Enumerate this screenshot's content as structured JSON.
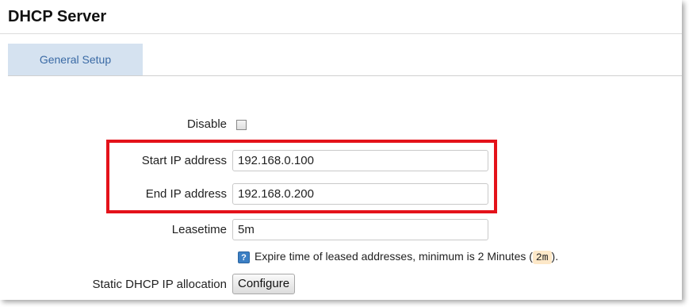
{
  "section": {
    "title": "DHCP Server"
  },
  "tabs": [
    {
      "label": "General Setup",
      "active": true
    }
  ],
  "fields": {
    "disable": {
      "label": "Disable",
      "checked": false
    },
    "start_ip": {
      "label": "Start IP address",
      "value": "192.168.0.100"
    },
    "end_ip": {
      "label": "End IP address",
      "value": "192.168.0.200"
    },
    "leasetime": {
      "label": "Leasetime",
      "value": "5m"
    },
    "lease_hint": {
      "icon": "help-icon",
      "icon_glyph": "?",
      "text_before": "Expire time of leased addresses, minimum is 2 Minutes (",
      "code": "2m",
      "text_after": ")."
    },
    "static_alloc": {
      "label": "Static DHCP IP allocation",
      "button_label": "Configure"
    }
  },
  "colors": {
    "highlight_border": "#e4121a",
    "tab_active_bg": "#d5e2f0",
    "tab_active_text": "#3a6aa5",
    "hint_icon": "#3b7fc4"
  }
}
